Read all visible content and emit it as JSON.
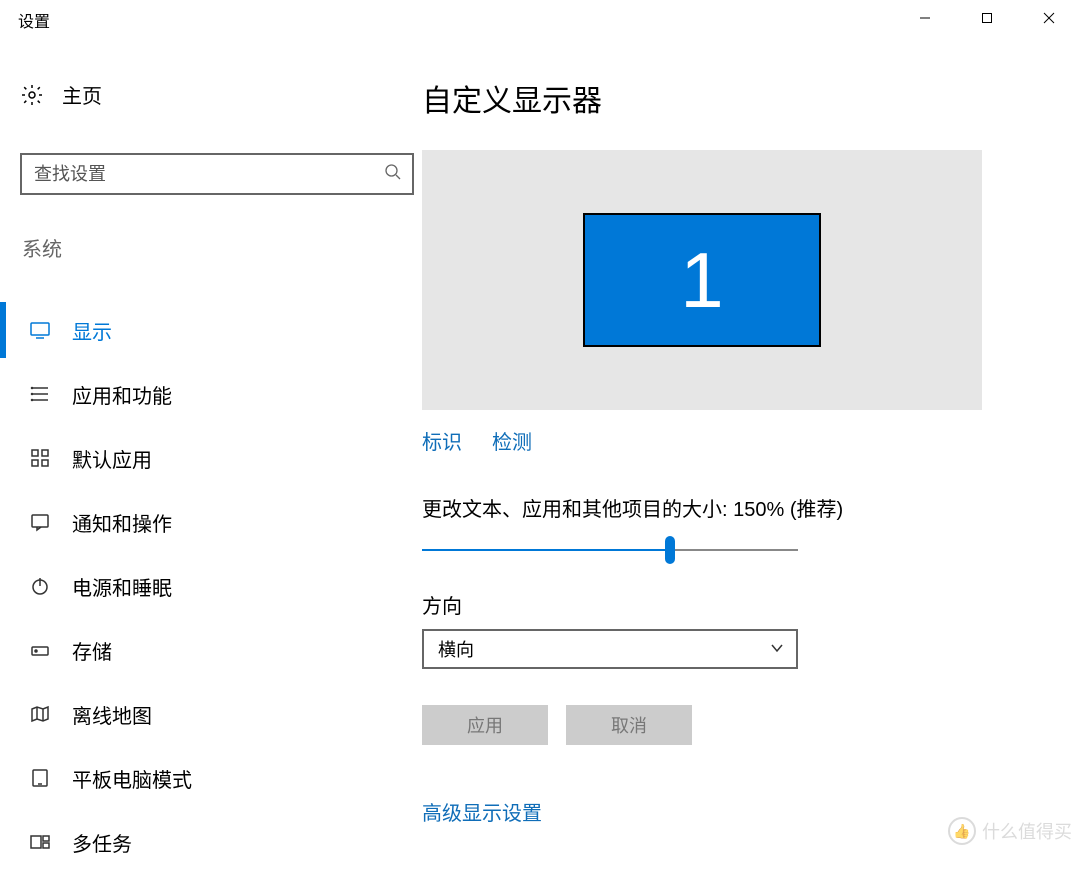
{
  "windowTitle": "设置",
  "sidebar": {
    "home": "主页",
    "searchPlaceholder": "查找设置",
    "category": "系统",
    "items": [
      {
        "key": "display",
        "label": "显示",
        "active": true
      },
      {
        "key": "apps",
        "label": "应用和功能",
        "active": false
      },
      {
        "key": "default",
        "label": "默认应用",
        "active": false
      },
      {
        "key": "notif",
        "label": "通知和操作",
        "active": false
      },
      {
        "key": "power",
        "label": "电源和睡眠",
        "active": false
      },
      {
        "key": "storage",
        "label": "存储",
        "active": false
      },
      {
        "key": "maps",
        "label": "离线地图",
        "active": false
      },
      {
        "key": "tablet",
        "label": "平板电脑模式",
        "active": false
      },
      {
        "key": "multitask",
        "label": "多任务",
        "active": false
      }
    ]
  },
  "content": {
    "heading": "自定义显示器",
    "monitorNumber": "1",
    "links": {
      "identify": "标识",
      "detect": "检测"
    },
    "scaleLabel": "更改文本、应用和其他项目的大小: 150% (推荐)",
    "sliderPercent": 66,
    "orientationLabel": "方向",
    "orientationValue": "横向",
    "applyBtn": "应用",
    "cancelBtn": "取消",
    "advancedLink": "高级显示设置"
  },
  "watermark": "什么值得买"
}
